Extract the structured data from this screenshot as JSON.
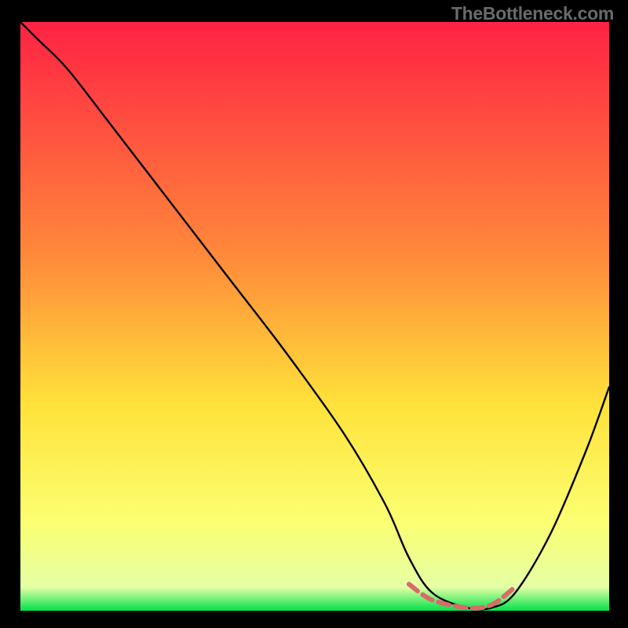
{
  "watermark": "TheBottleneck.com",
  "chart_data": {
    "type": "line",
    "title": "",
    "xlabel": "",
    "ylabel": "",
    "xlim": [
      0,
      100
    ],
    "ylim": [
      0,
      100
    ],
    "grid": false,
    "legend": false,
    "background": {
      "type": "vertical-gradient",
      "stops": [
        {
          "offset": 0,
          "color": "#ff2244"
        },
        {
          "offset": 40,
          "color": "#ff8a3a"
        },
        {
          "offset": 65,
          "color": "#ffe23a"
        },
        {
          "offset": 85,
          "color": "#fbff72"
        },
        {
          "offset": 96,
          "color": "#e5ffa5"
        },
        {
          "offset": 100,
          "color": "#00e24a"
        }
      ]
    },
    "series": [
      {
        "name": "bottleneck-curve",
        "color": "#000000",
        "x": [
          0,
          3,
          8,
          15,
          25,
          35,
          45,
          55,
          62,
          66,
          70,
          76,
          80,
          84,
          90,
          96,
          100
        ],
        "y": [
          100,
          97,
          92,
          83,
          70,
          57,
          44,
          30,
          18,
          9,
          3,
          0.5,
          0.5,
          3,
          13,
          27,
          38
        ]
      },
      {
        "name": "optimal-zone",
        "color": "#d96a6a",
        "stroke_width": 6,
        "x": [
          66,
          70,
          76,
          80,
          84
        ],
        "y": [
          4.5,
          1.8,
          0.5,
          1.0,
          4.0
        ]
      }
    ]
  }
}
